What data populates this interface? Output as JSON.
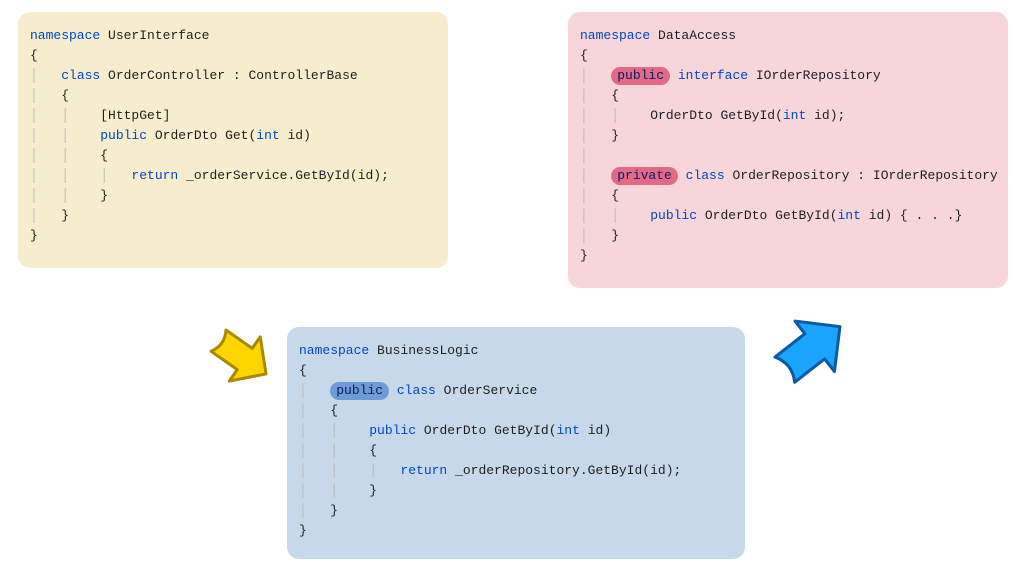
{
  "ui_box": {
    "ns_kw": "namespace",
    "ns_name": "UserInterface",
    "class_kw": "class",
    "class_name": "OrderController",
    "base_sep": " : ",
    "base_name": "ControllerBase",
    "attr_open": "[",
    "attr_name": "HttpGet",
    "attr_close": "]",
    "meth_mod": "public",
    "meth_type": "OrderDto",
    "meth_name": "Get",
    "meth_sig_open": "(",
    "meth_ptype": "int",
    "meth_pname": " id",
    "meth_sig_close": ")",
    "ret_kw": "return",
    "ret_expr_pre": " _orderService.GetById(",
    "ret_expr_arg": "id",
    "ret_expr_post": ");"
  },
  "da_box": {
    "ns_kw": "namespace",
    "ns_name": "DataAccess",
    "iface_mod": "public",
    "iface_kw": "interface",
    "iface_name": "IOrderRepository",
    "iface_meth_type": "OrderDto",
    "iface_meth_name": "GetById",
    "iface_meth_sig_open": "(",
    "iface_meth_ptype": "int",
    "iface_meth_pname": " id",
    "iface_meth_sig_close": ");",
    "cls_mod": "private",
    "cls_kw": "class",
    "cls_name": "OrderRepository",
    "cls_base_sep": " : ",
    "cls_base": "IOrderRepository",
    "cls_meth_mod": "public",
    "cls_meth_type": "OrderDto",
    "cls_meth_name": "GetById",
    "cls_meth_sig_open": "(",
    "cls_meth_ptype": "int",
    "cls_meth_pname": " id",
    "cls_meth_sig_close": ")",
    "cls_body": " { . . .}"
  },
  "bl_box": {
    "ns_kw": "namespace",
    "ns_name": "BusinessLogic",
    "cls_mod": "public",
    "cls_kw": "class",
    "cls_name": "OrderService",
    "meth_mod": "public",
    "meth_type": "OrderDto",
    "meth_name": "GetById",
    "meth_sig_open": "(",
    "meth_ptype": "int",
    "meth_pname": " id",
    "meth_sig_close": ")",
    "ret_kw": "return",
    "ret_expr_pre": " _orderRepository.GetById(",
    "ret_expr_arg": "id",
    "ret_expr_post": ");"
  },
  "colors": {
    "yellow": "#f6edce",
    "pink": "#f6d6da",
    "blue_panel": "#c8d8eb",
    "kw": "#0045c4",
    "hl_red": "#e06a87",
    "hl_blue": "#6e9bd6",
    "arrow_yellow_fill": "#ffd500",
    "arrow_yellow_stroke": "#a88a00",
    "arrow_blue_fill": "#1aa3ff",
    "arrow_blue_stroke": "#0a5aa6"
  }
}
